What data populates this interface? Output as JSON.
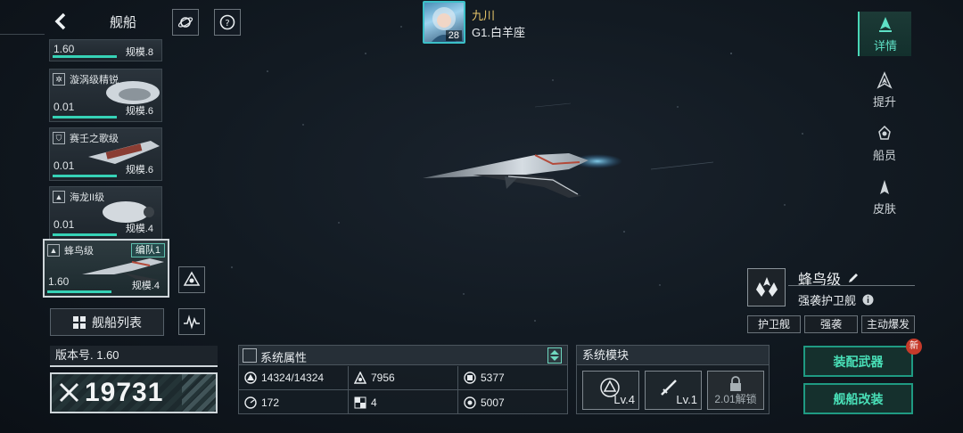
{
  "header": {
    "title": "舰船"
  },
  "player": {
    "name": "九川",
    "level": "28",
    "rank": "G1.白羊座"
  },
  "ship_list": [
    {
      "name": "",
      "value": "1.60",
      "scale": "规模.8"
    },
    {
      "name": "漩涡级精锐",
      "value": "0.01",
      "scale": "规模.6"
    },
    {
      "name": "赛壬之歌级",
      "value": "0.01",
      "scale": "规模.6"
    },
    {
      "name": "海龙II级",
      "value": "0.01",
      "scale": "规模.4"
    },
    {
      "name": "蜂鸟级",
      "value": "1.60",
      "scale": "规模.4",
      "tag": "编队1"
    }
  ],
  "ship_list_button": "舰船列表",
  "version": "版本号. 1.60",
  "power": "19731",
  "attributes": {
    "title": "系统属性",
    "values": [
      "14324/14324",
      "7956",
      "5377",
      "172",
      "4",
      "5007"
    ]
  },
  "modules": {
    "title": "系统模块",
    "items": [
      "Lv.4",
      "Lv.1",
      "2.01解锁"
    ]
  },
  "ship": {
    "name": "蜂鸟级",
    "class": "强袭护卫舰",
    "tags": [
      "护卫舰",
      "强袭",
      "主动爆发"
    ]
  },
  "actions": {
    "equip": "装配武器",
    "modify": "舰船改装",
    "new_badge": "新"
  },
  "right_nav": [
    "详情",
    "提升",
    "船员",
    "皮肤"
  ],
  "colors": {
    "accent": "#5fe1c6",
    "fleet_tag": "#25484a",
    "new_badge": "#c63a2a"
  }
}
